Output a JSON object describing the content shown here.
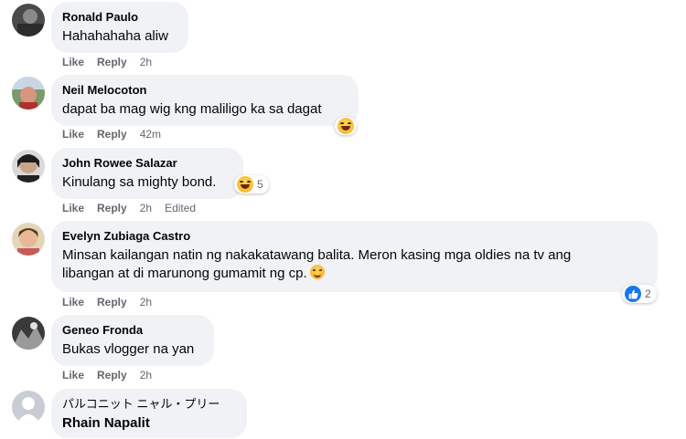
{
  "actions": {
    "like": "Like",
    "reply": "Reply",
    "edited": "Edited"
  },
  "comments": [
    {
      "author": "Ronald Paulo",
      "text": "Hahahahaha aliw",
      "time": "2h"
    },
    {
      "author": "Neil Melocoton",
      "text": "dapat ba mag wig kng maliligo ka sa dagat",
      "time": "42m",
      "reaction": "haha"
    },
    {
      "author": "John Rowee Salazar",
      "text": "Kinulang sa mighty bond.",
      "time": "2h",
      "reaction": "haha",
      "reaction_count": "5",
      "edited": true
    },
    {
      "author": "Evelyn Zubiaga Castro",
      "text_line1": "Minsan kailangan natin ng nakakatawang balita. Meron kasing mga oldies na tv ang",
      "text_line2": "libangan at di marunong gumamit ng cp.",
      "time": "2h",
      "reaction": "like",
      "reaction_count": "2",
      "inline_emoji": "smiling-face"
    },
    {
      "author": "Geneo Fronda",
      "text": "Bukas vlogger na yan",
      "time": "2h"
    },
    {
      "author": "パルコニット ニャル・プリー",
      "text": "Rhain Napalit"
    }
  ]
}
